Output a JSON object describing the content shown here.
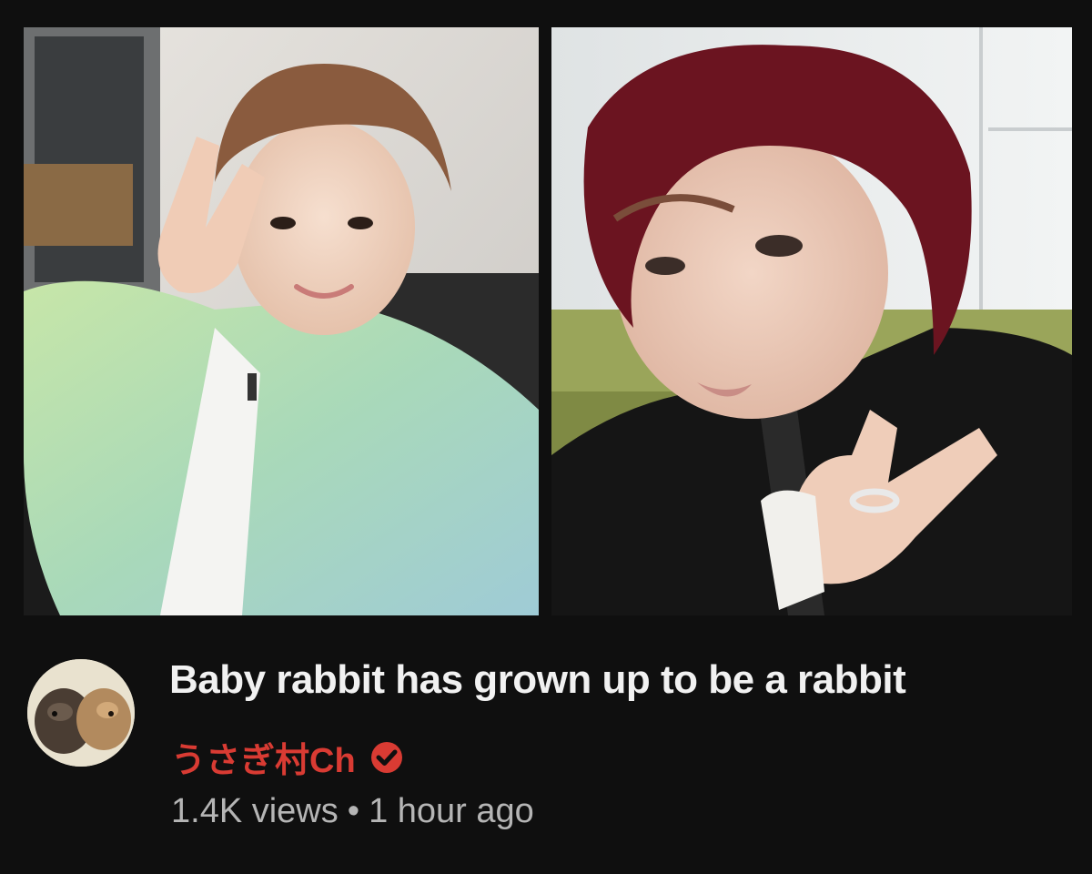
{
  "video": {
    "title": "Baby rabbit has grown up to be a rabbit",
    "thumbnails": [
      {
        "name": "left-photo",
        "icon": "portrait-photo"
      },
      {
        "name": "right-photo",
        "icon": "portrait-photo"
      }
    ]
  },
  "channel": {
    "name": "うさぎ村Ch",
    "verified_icon": "verified-check-icon",
    "avatar_icon": "rabbits-avatar"
  },
  "stats": {
    "views": "1.4K views",
    "separator": "•",
    "age": "1 hour ago"
  },
  "colors": {
    "background": "#0f0f0f",
    "title": "#f1f1f1",
    "channel": "#d93b33",
    "stats": "#b5b5b5"
  }
}
